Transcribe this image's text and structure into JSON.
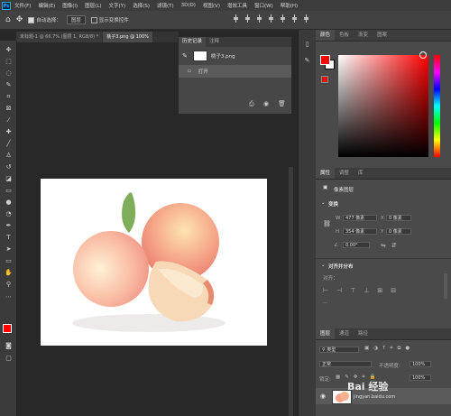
{
  "menu": {
    "logo": "Ps",
    "items": [
      "文件(F)",
      "编辑(E)",
      "图像(I)",
      "图层(L)",
      "文字(Y)",
      "选择(S)",
      "滤镜(T)",
      "3D(D)",
      "视图(V)",
      "增效工具",
      "窗口(W)",
      "帮助(H)"
    ]
  },
  "options": {
    "auto_select_label": "自动选择：",
    "auto_select_value": "图层",
    "show_transform_label": "显示变换控件"
  },
  "tabs": {
    "doc1": "未标题-1 @ 66.7% (图层 1, RGB/8) *",
    "doc2": "桃子3.png @ 100%"
  },
  "history": {
    "tab_history": "历史记录",
    "tab_comments": "注释",
    "snapshot": "桃子3.png",
    "step": "打开"
  },
  "color_panel": {
    "tabs": [
      "颜色",
      "色板",
      "渐变",
      "图案"
    ],
    "foreground": "#ff0000",
    "background": "#ffffff"
  },
  "properties": {
    "tabs": [
      "属性",
      "调整",
      "库"
    ],
    "layer_type": "像素图层",
    "transform_title": "变换",
    "w_label": "W",
    "w_value": "477 像素",
    "x_label": "X",
    "x_value": "0 像素",
    "h_label": "H",
    "h_value": "354 像素",
    "y_label": "Y",
    "y_value": "0 像素",
    "angle": "0.00°",
    "align_title": "对齐并分布",
    "align_label": "对齐："
  },
  "layers": {
    "tabs": [
      "图层",
      "通道",
      "路径"
    ],
    "filter": "类型",
    "blend_mode": "正常",
    "opacity_label": "不透明度:",
    "opacity_value": "100%",
    "lock_label": "锁定:",
    "fill_value": "100%"
  },
  "watermark": {
    "main": "Bai 经验",
    "sub": "jingyan.baidu.com"
  }
}
